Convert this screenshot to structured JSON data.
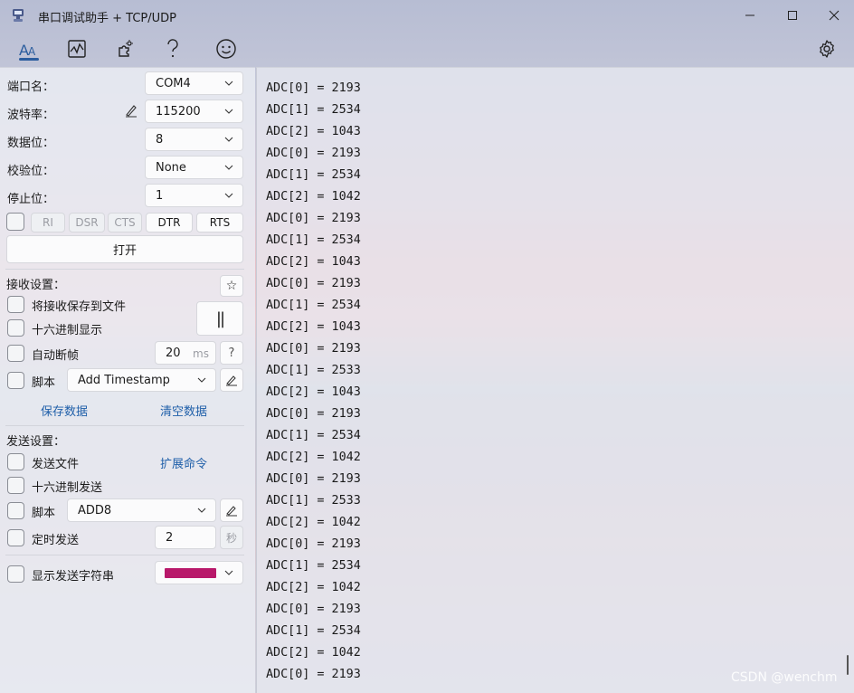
{
  "window": {
    "title": "串口调试助手 + TCP/UDP",
    "minimize_icon": "minimize-icon",
    "maximize_icon": "maximize-icon",
    "close_icon": "close-icon"
  },
  "toolbar": {
    "items": [
      "font-icon",
      "chart-icon",
      "plugin-icon",
      "help-icon",
      "smiley-icon"
    ],
    "settings_icon": "gear-icon",
    "active_item": "font-icon"
  },
  "serial": {
    "port_label": "端口名：",
    "port_value": "COM4",
    "baud_label": "波特率：",
    "baud_value": "115200",
    "databits_label": "数据位：",
    "databits_value": "8",
    "parity_label": "校验位：",
    "parity_value": "None",
    "stopbits_label": "停止位：",
    "stopbits_value": "1",
    "signals": [
      "RI",
      "DSR",
      "CTS",
      "DTR",
      "RTS"
    ],
    "open_label": "打开"
  },
  "receive": {
    "header": "接收设置：",
    "save_to_file": "将接收保存到文件",
    "hex_display": "十六进制显示",
    "auto_frame": "自动断帧",
    "auto_frame_value": "20",
    "auto_frame_unit": "ms",
    "help_label": "?",
    "script_label": "脚本",
    "script_value": "Add Timestamp",
    "save_data": "保存数据",
    "clear_data": "清空数据",
    "pause_label": "||",
    "star_label": "☆"
  },
  "send": {
    "header": "发送设置：",
    "send_file": "发送文件",
    "ext_cmd": "扩展命令",
    "hex_send": "十六进制发送",
    "script_label": "脚本",
    "script_value": "ADD8",
    "timed_send": "定时发送",
    "timed_value": "2",
    "timed_unit": "秒",
    "show_send": "显示发送字符串",
    "send_color": "#b8186a"
  },
  "log": {
    "lines": [
      "ADC[0] = 2193",
      "ADC[1] = 2534",
      "ADC[2] = 1043",
      "ADC[0] = 2193",
      "ADC[1] = 2534",
      "ADC[2] = 1042",
      "ADC[0] = 2193",
      "ADC[1] = 2534",
      "ADC[2] = 1043",
      "ADC[0] = 2193",
      "ADC[1] = 2534",
      "ADC[2] = 1043",
      "ADC[0] = 2193",
      "ADC[1] = 2533",
      "ADC[2] = 1043",
      "ADC[0] = 2193",
      "ADC[1] = 2534",
      "ADC[2] = 1042",
      "ADC[0] = 2193",
      "ADC[1] = 2533",
      "ADC[2] = 1042",
      "ADC[0] = 2193",
      "ADC[1] = 2534",
      "ADC[2] = 1042",
      "ADC[0] = 2193",
      "ADC[1] = 2534",
      "ADC[2] = 1042",
      "ADC[0] = 2193"
    ]
  },
  "watermark": "CSDN @wenchm"
}
